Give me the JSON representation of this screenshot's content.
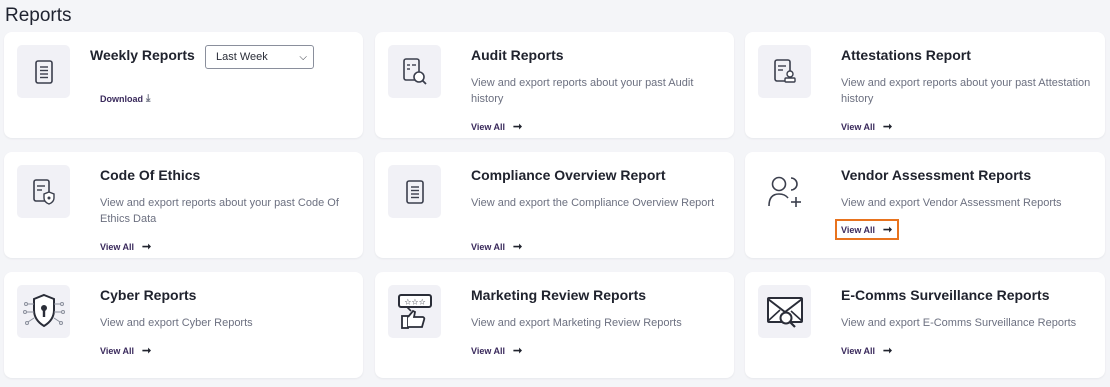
{
  "page": {
    "title": "Reports"
  },
  "cards": {
    "weekly": {
      "title": "Weekly Reports",
      "period_select": {
        "value": "Last Week"
      },
      "download_label": "Download",
      "icon": "document-icon"
    },
    "audit": {
      "title": "Audit Reports",
      "description": "View and export reports about your past Audit history",
      "link": "View All",
      "icon": "audit-search-icon"
    },
    "attestations": {
      "title": "Attestations Report",
      "description": "View and export reports about your past Attestation history",
      "link": "View All",
      "icon": "attestation-document-icon"
    },
    "ethics": {
      "title": "Code Of Ethics",
      "description": "View and export reports about your past Code Of Ethics Data",
      "link": "View All",
      "icon": "ethics-shield-document-icon"
    },
    "compliance": {
      "title": "Compliance Overview Report",
      "description": "View and export the Compliance Overview Report",
      "link": "View All",
      "icon": "document-icon"
    },
    "vendor": {
      "title": "Vendor Assessment Reports",
      "description": "View and export Vendor Assessment Reports",
      "link": "View All",
      "icon": "add-user-icon"
    },
    "cyber": {
      "title": "Cyber Reports",
      "description": "View and export Cyber Reports",
      "link": "View All",
      "icon": "cyber-shield-icon"
    },
    "marketing": {
      "title": "Marketing Review Reports",
      "description": "View and export Marketing Review Reports",
      "link": "View All",
      "icon": "thumbs-up-review-icon"
    },
    "ecomms": {
      "title": "E-Comms Surveillance Reports",
      "description": "View and export E-Comms Surveillance Reports",
      "link": "View All",
      "icon": "mail-search-icon"
    }
  },
  "colors": {
    "background": "#f4f5f8",
    "card": "#ffffff",
    "link": "#3a2a5c",
    "focus_outline": "#e8731e"
  }
}
